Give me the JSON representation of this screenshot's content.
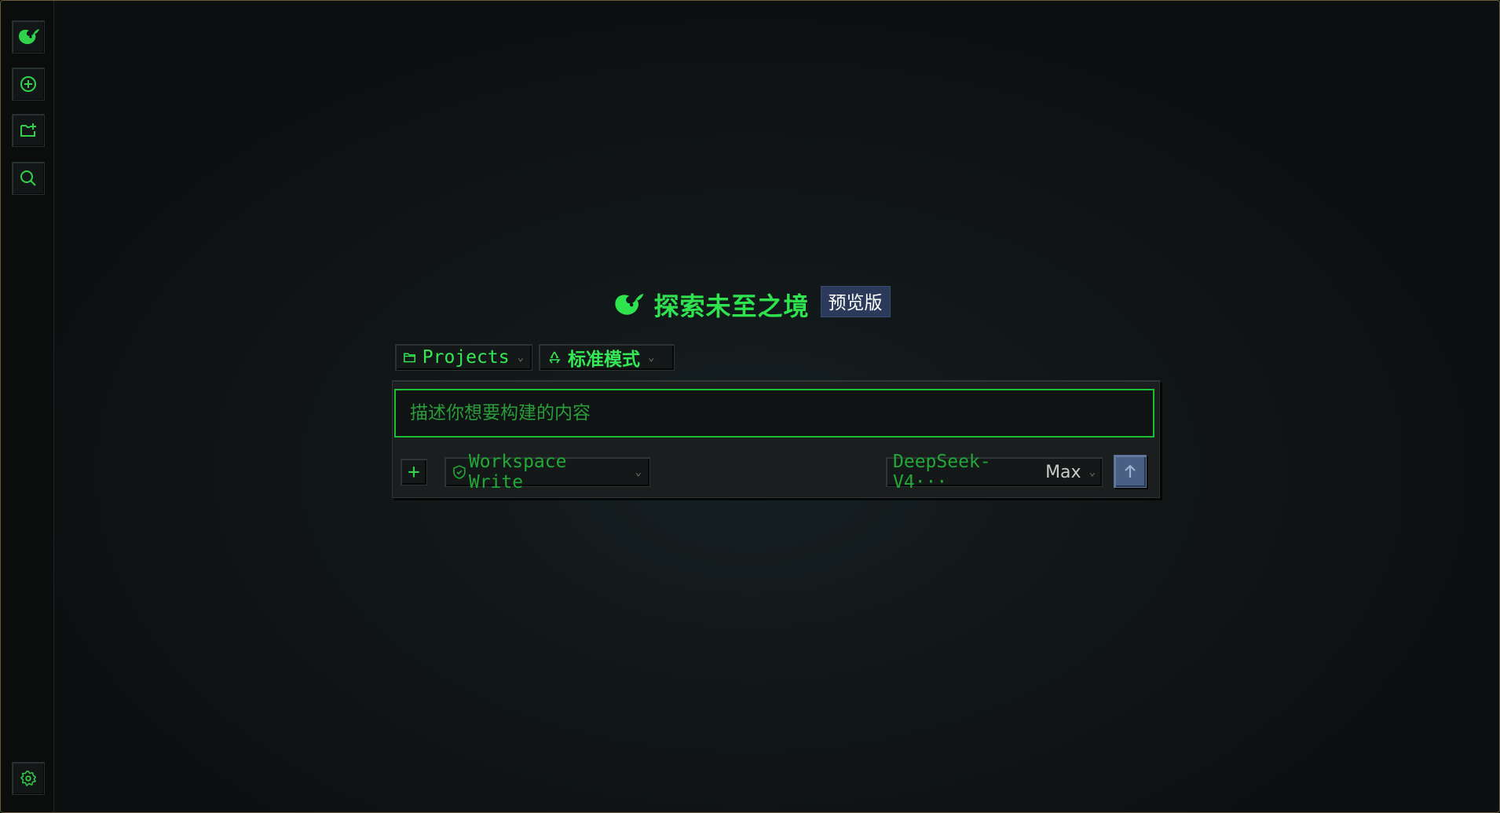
{
  "sidebar": {
    "buttons": [
      {
        "icon": "whale-logo-icon"
      },
      {
        "icon": "new-chat-icon"
      },
      {
        "icon": "new-folder-icon"
      },
      {
        "icon": "search-icon"
      }
    ],
    "bottom_icon": "settings-gear-icon"
  },
  "hero": {
    "title": "探索未至之境",
    "badge": "预览版"
  },
  "selectors": {
    "projects_label": "Projects",
    "mode_label": "标准模式"
  },
  "composer": {
    "placeholder": "描述你想要构建的内容",
    "workspace_label": "Workspace Write",
    "model_label": "DeepSeek-V4···",
    "effort_label": "Max"
  },
  "colors": {
    "accent_green": "#2fd24a",
    "send_button": "#4a5f84",
    "badge_bg": "#2b3a5a",
    "frame_border": "#6a5a3e"
  }
}
